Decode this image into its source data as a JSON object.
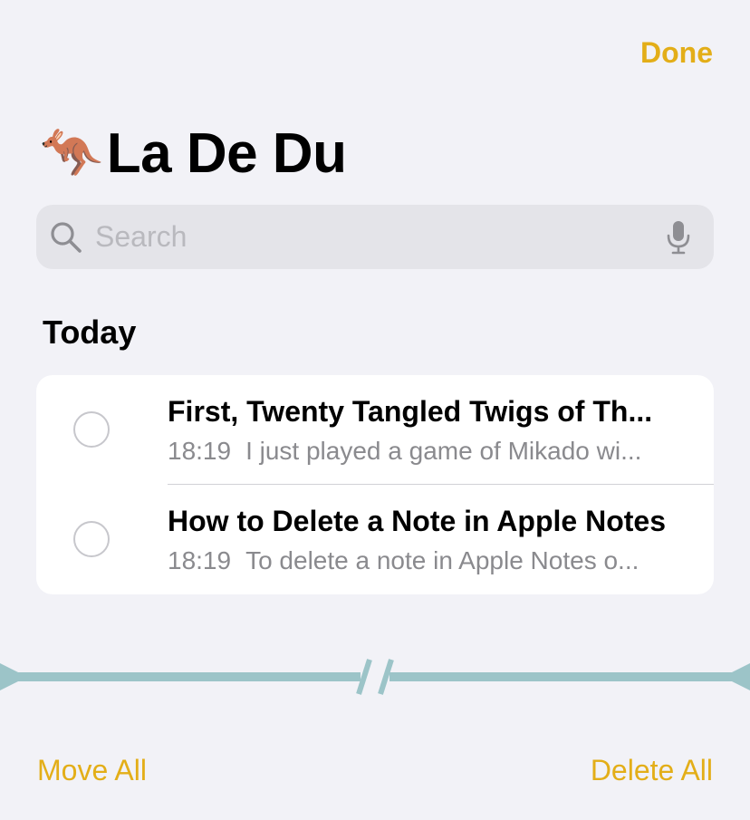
{
  "header": {
    "done_label": "Done"
  },
  "folder": {
    "emoji": "🦘",
    "title": "La De Du"
  },
  "search": {
    "placeholder": "Search",
    "value": ""
  },
  "section": {
    "label": "Today"
  },
  "notes": [
    {
      "title": "First, Twenty Tangled Twigs of Th...",
      "time": "18:19",
      "preview": "I just played a game of Mikado wi..."
    },
    {
      "title": "How to Delete a Note in Apple Notes",
      "time": "18:19",
      "preview": "To delete a note in Apple Notes o..."
    }
  ],
  "toolbar": {
    "move_all_label": "Move All",
    "delete_all_label": "Delete All"
  },
  "colors": {
    "accent": "#E3AE18",
    "background": "#F2F2F7",
    "divider_graphic": "#9CC4C8"
  },
  "icons": {
    "search": "search-icon",
    "mic": "microphone-icon",
    "radio": "radio-circle-icon"
  }
}
